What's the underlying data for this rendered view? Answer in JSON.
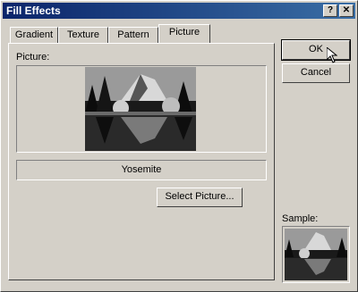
{
  "window": {
    "title": "Fill Effects"
  },
  "titlebar": {
    "help_label": "?",
    "close_label": "✕"
  },
  "tabs": [
    {
      "label": "Gradient"
    },
    {
      "label": "Texture"
    },
    {
      "label": "Pattern"
    },
    {
      "label": "Picture"
    }
  ],
  "picture": {
    "section_label": "Picture:",
    "name": "Yosemite",
    "select_button": "Select Picture...",
    "sample_label": "Sample:"
  },
  "buttons": {
    "ok": "OK",
    "cancel": "Cancel"
  }
}
